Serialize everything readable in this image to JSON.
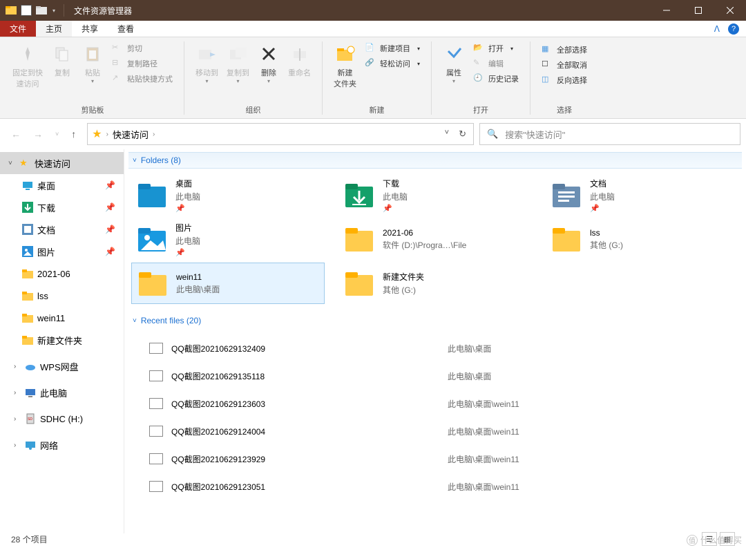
{
  "window": {
    "title": "文件资源管理器"
  },
  "tabs": {
    "file": "文件",
    "home": "主页",
    "share": "共享",
    "view": "查看"
  },
  "ribbon": {
    "clipboard": {
      "label": "剪贴板",
      "pin": "固定到快\n速访问",
      "copy": "复制",
      "paste": "粘贴",
      "cut": "剪切",
      "copy_path": "复制路径",
      "paste_shortcut": "粘贴快捷方式"
    },
    "organize": {
      "label": "组织",
      "move_to": "移动到",
      "copy_to": "复制到",
      "delete": "删除",
      "rename": "重命名"
    },
    "new": {
      "label": "新建",
      "new_folder": "新建\n文件夹",
      "new_item": "新建项目",
      "easy_access": "轻松访问"
    },
    "open": {
      "label": "打开",
      "properties": "属性",
      "open": "打开",
      "edit": "编辑",
      "history": "历史记录"
    },
    "select": {
      "label": "选择",
      "select_all": "全部选择",
      "select_none": "全部取消",
      "invert": "反向选择"
    }
  },
  "addr": {
    "crumb": "快速访问",
    "search_placeholder": "搜索\"快速访问\""
  },
  "sidebar": {
    "quick": "快速访问",
    "pinned": [
      {
        "name": "桌面",
        "icon": "desktop",
        "pin": true
      },
      {
        "name": "下载",
        "icon": "downloads",
        "pin": true
      },
      {
        "name": "文档",
        "icon": "documents",
        "pin": true
      },
      {
        "name": "图片",
        "icon": "pictures",
        "pin": true
      },
      {
        "name": "2021-06",
        "icon": "folder",
        "pin": false
      },
      {
        "name": "lss",
        "icon": "folder",
        "pin": false
      },
      {
        "name": "wein11",
        "icon": "folder",
        "pin": false
      },
      {
        "name": "新建文件夹",
        "icon": "folder",
        "pin": false
      }
    ],
    "other": [
      {
        "name": "WPS网盘",
        "icon": "cloud"
      },
      {
        "name": "此电脑",
        "icon": "pc"
      },
      {
        "name": "SDHC (H:)",
        "icon": "sd"
      },
      {
        "name": "网络",
        "icon": "network"
      }
    ]
  },
  "groups": {
    "folders_label": "Folders (8)",
    "recent_label": "Recent files (20)"
  },
  "folders": [
    {
      "name": "桌面",
      "loc": "此电脑",
      "pin": true,
      "icon": "desktop"
    },
    {
      "name": "下载",
      "loc": "此电脑",
      "pin": true,
      "icon": "downloads"
    },
    {
      "name": "文档",
      "loc": "此电脑",
      "pin": true,
      "icon": "documents"
    },
    {
      "name": "图片",
      "loc": "此电脑",
      "pin": true,
      "icon": "pictures"
    },
    {
      "name": "2021-06",
      "loc": "软件 (D:)\\Progra…\\File",
      "pin": false,
      "icon": "folder"
    },
    {
      "name": "lss",
      "loc": "其他 (G:)",
      "pin": false,
      "icon": "folder"
    },
    {
      "name": "wein11",
      "loc": "此电脑\\桌面",
      "pin": false,
      "icon": "folder",
      "selected": true
    },
    {
      "name": "新建文件夹",
      "loc": "其他 (G:)",
      "pin": false,
      "icon": "folder"
    }
  ],
  "recent": [
    {
      "name": "QQ截图20210629132409",
      "loc": "此电脑\\桌面"
    },
    {
      "name": "QQ截图20210629135118",
      "loc": "此电脑\\桌面"
    },
    {
      "name": "QQ截图20210629123603",
      "loc": "此电脑\\桌面\\wein11"
    },
    {
      "name": "QQ截图20210629124004",
      "loc": "此电脑\\桌面\\wein11"
    },
    {
      "name": "QQ截图20210629123929",
      "loc": "此电脑\\桌面\\wein11"
    },
    {
      "name": "QQ截图20210629123051",
      "loc": "此电脑\\桌面\\wein11"
    }
  ],
  "status": {
    "text": "28 个项目"
  },
  "watermark": "什么值得买"
}
